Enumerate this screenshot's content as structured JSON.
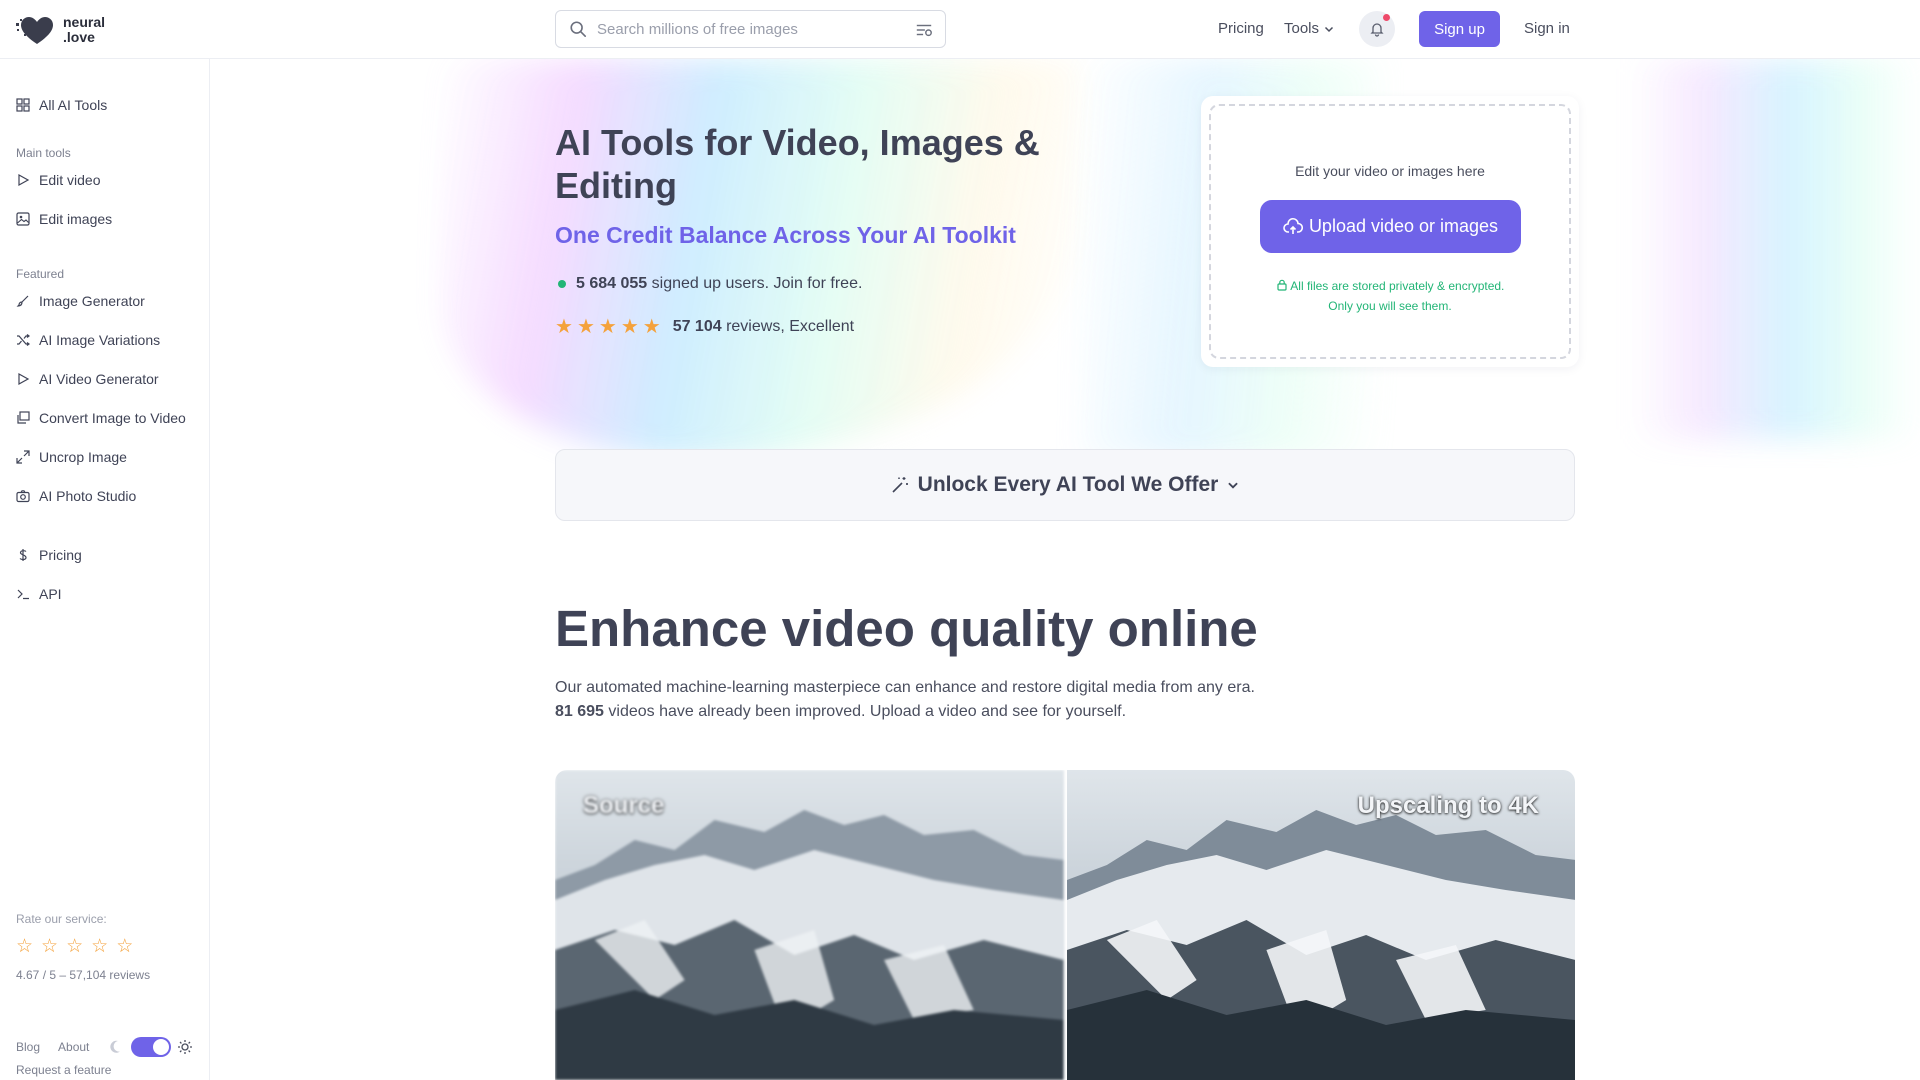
{
  "logo": {
    "line1": "neural",
    "line2": ".love"
  },
  "search": {
    "placeholder": "Search millions of free images"
  },
  "topnav": {
    "pricing": "Pricing",
    "tools": "Tools",
    "signup": "Sign up",
    "signin": "Sign in"
  },
  "sidebar": {
    "all_tools": "All AI Tools",
    "main_group": "Main tools",
    "main_items": [
      {
        "label": "Edit video",
        "icon": "play-icon"
      },
      {
        "label": "Edit images",
        "icon": "image-icon"
      }
    ],
    "featured_group": "Featured",
    "featured_items": [
      {
        "label": "Image Generator",
        "icon": "brush-icon"
      },
      {
        "label": "AI Image Variations",
        "icon": "shuffle-icon"
      },
      {
        "label": "AI Video Generator",
        "icon": "play-icon"
      },
      {
        "label": "Convert Image to Video",
        "icon": "gallery-icon"
      },
      {
        "label": "Uncrop Image",
        "icon": "expand-icon"
      },
      {
        "label": "AI Photo Studio",
        "icon": "camera-icon"
      }
    ],
    "pricing": "Pricing",
    "api": "API",
    "rate_label": "Rate our service:",
    "rate_summary": "4.67 / 5 – 57,104 reviews",
    "blog": "Blog",
    "about": "About",
    "request": "Request a feature"
  },
  "hero": {
    "title": "AI Tools for Video, Images & Editing",
    "subtitle": "One Credit Balance Across Your AI Toolkit",
    "users_count": "5 684 055",
    "users_text": "signed up users. Join for free.",
    "reviews_count": "57 104",
    "reviews_text": "reviews, Excellent",
    "rating_stars": 5
  },
  "upload": {
    "label": "Edit your video or images here",
    "button": "Upload video or images",
    "secure_line1": "All files are stored privately & encrypted.",
    "secure_line2": "Only you will see them."
  },
  "unlock": {
    "label": "Unlock Every AI Tool We Offer"
  },
  "enhance": {
    "title": "Enhance video quality online",
    "desc_line1": "Our automated machine-learning masterpiece can enhance and restore digital media from any era.",
    "count": "81 695",
    "desc_line2_rest": "videos have already been improved. Upload a video and see for yourself."
  },
  "compare": {
    "left_label": "Source",
    "right_label": "Upscaling to 4K"
  },
  "colors": {
    "accent": "#6f63e8",
    "green": "#22b576",
    "star": "#f4a23c",
    "text": "#3f4356"
  }
}
